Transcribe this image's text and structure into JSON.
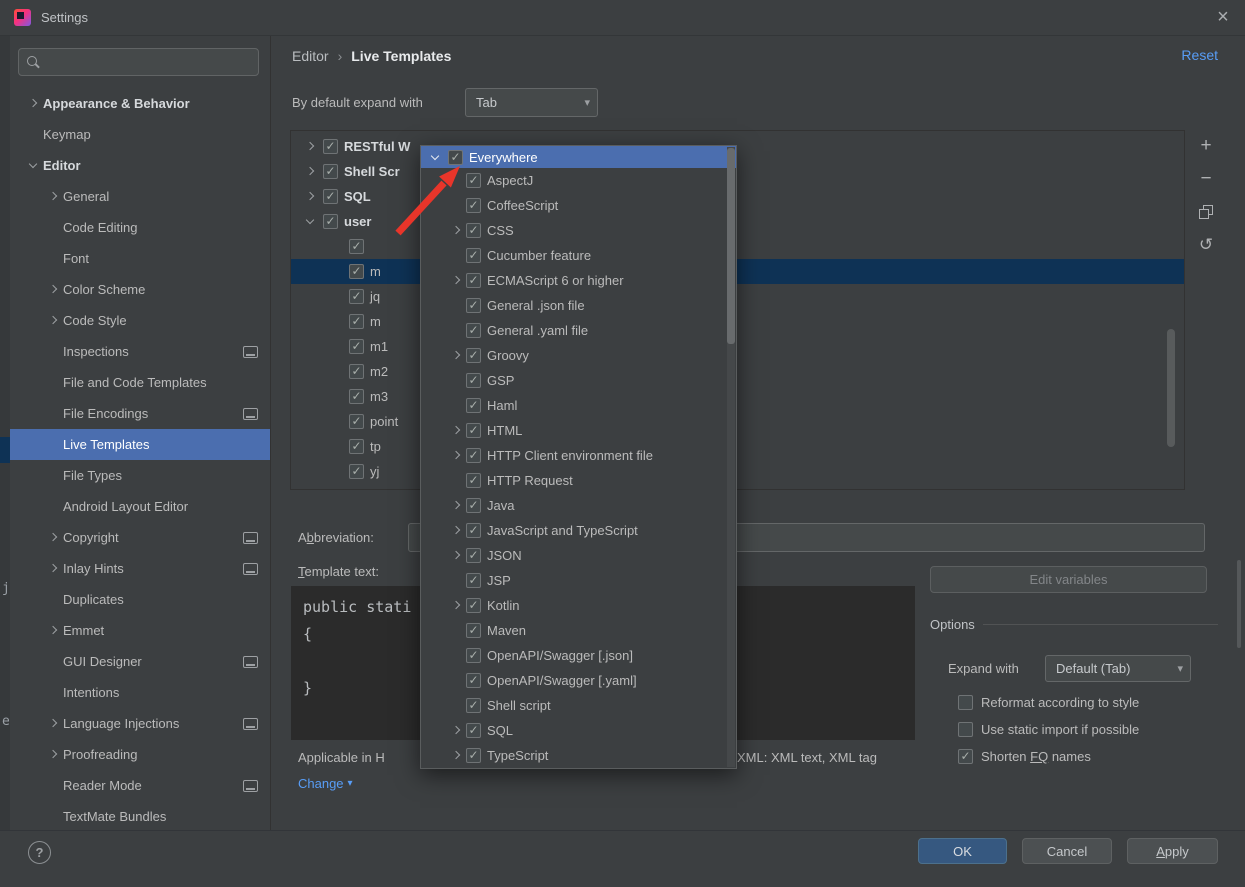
{
  "colors": {
    "background": "#3c3f41",
    "editor_background": "#2b2b2b",
    "selection_blue": "#4b6eaf",
    "inactive_selection": "#0e3255",
    "link_blue": "#589df6",
    "primary_button": "#365880",
    "annotation_red": "#e8352a"
  },
  "icons": {
    "close": "×",
    "add": "+",
    "remove": "−",
    "revert": "↺",
    "dropdown": "▾"
  },
  "title_bar": {
    "title": "Settings"
  },
  "background_strip": {
    "fragments": [
      "j",
      "e"
    ]
  },
  "sidebar": {
    "search": {
      "value": "",
      "placeholder": ""
    },
    "items": [
      {
        "label": "Appearance & Behavior",
        "level": 0,
        "chevron": "collapsed",
        "bold": true
      },
      {
        "label": "Keymap",
        "level": 0
      },
      {
        "label": "Editor",
        "level": 0,
        "chevron": "expanded",
        "bold": true
      },
      {
        "label": "General",
        "level": 1,
        "chevron": "collapsed"
      },
      {
        "label": "Code Editing",
        "level": 1
      },
      {
        "label": "Font",
        "level": 1
      },
      {
        "label": "Color Scheme",
        "level": 1,
        "chevron": "collapsed"
      },
      {
        "label": "Code Style",
        "level": 1,
        "chevron": "collapsed"
      },
      {
        "label": "Inspections",
        "level": 1,
        "monitor": true
      },
      {
        "label": "File and Code Templates",
        "level": 1
      },
      {
        "label": "File Encodings",
        "level": 1,
        "monitor": true
      },
      {
        "label": "Live Templates",
        "level": 1,
        "selected": true
      },
      {
        "label": "File Types",
        "level": 1
      },
      {
        "label": "Android Layout Editor",
        "level": 1
      },
      {
        "label": "Copyright",
        "level": 1,
        "chevron": "collapsed",
        "monitor": true
      },
      {
        "label": "Inlay Hints",
        "level": 1,
        "chevron": "collapsed",
        "monitor": true
      },
      {
        "label": "Duplicates",
        "level": 1
      },
      {
        "label": "Emmet",
        "level": 1,
        "chevron": "collapsed"
      },
      {
        "label": "GUI Designer",
        "level": 1,
        "monitor": true
      },
      {
        "label": "Intentions",
        "level": 1
      },
      {
        "label": "Language Injections",
        "level": 1,
        "chevron": "collapsed",
        "monitor": true
      },
      {
        "label": "Proofreading",
        "level": 1,
        "chevron": "collapsed"
      },
      {
        "label": "Reader Mode",
        "level": 1,
        "monitor": true
      },
      {
        "label": "TextMate Bundles",
        "level": 1
      }
    ]
  },
  "header": {
    "breadcrumb": [
      "Editor",
      "Live Templates"
    ],
    "separator": "›",
    "reset": "Reset"
  },
  "expand_with": {
    "label": "By default expand with",
    "value": "Tab"
  },
  "template_list": {
    "rows": [
      {
        "label": "RESTful W",
        "level": 0,
        "chevron": "collapsed",
        "checked": true,
        "bold": true
      },
      {
        "label": "Shell Scr",
        "level": 0,
        "chevron": "collapsed",
        "checked": true,
        "bold": true
      },
      {
        "label": "SQL",
        "level": 0,
        "chevron": "collapsed",
        "checked": true,
        "bold": true
      },
      {
        "label": "user",
        "level": 0,
        "chevron": "expanded",
        "checked": true,
        "bold": true
      },
      {
        "label": "",
        "level": 1,
        "checked": true
      },
      {
        "label": "m",
        "level": 1,
        "checked": true,
        "selected": true
      },
      {
        "label": "jq",
        "level": 1,
        "checked": true
      },
      {
        "label": "m",
        "level": 1,
        "checked": true
      },
      {
        "label": "m1",
        "level": 1,
        "checked": true
      },
      {
        "label": "m2",
        "level": 1,
        "checked": true
      },
      {
        "label": "m3",
        "level": 1,
        "checked": true
      },
      {
        "label": "point",
        "level": 1,
        "checked": true
      },
      {
        "label": "tp",
        "level": 1,
        "checked": true
      },
      {
        "label": "yj",
        "level": 1,
        "checked": true
      }
    ]
  },
  "abbreviation": {
    "pre": "A",
    "u": "b",
    "post": "breviation:",
    "value": ""
  },
  "template_text": {
    "label_u": "T",
    "label_post": "emplate text:",
    "code_lines": [
      "public stati",
      "{",
      "",
      "}"
    ]
  },
  "edit_variables": "Edit variables",
  "options": {
    "title": "Options",
    "expand_with_label": "Expand with",
    "expand_with_value": "Default (Tab)",
    "checkboxes": [
      {
        "pre": "",
        "u": "",
        "post": "Reformat according to style",
        "checked": false
      },
      {
        "pre": "",
        "u": "",
        "post": "Use static import if possible",
        "checked": false
      },
      {
        "pre": "Shorten ",
        "u": "FQ",
        "post": " names",
        "checked": true
      }
    ]
  },
  "applicable": {
    "left_fragment": "Applicable in H",
    "right_fragment": "XML: XML text, XML tag",
    "change_link": "Change"
  },
  "context_popup": {
    "header": {
      "label": "Everywhere",
      "checked": true
    },
    "items": [
      {
        "label": "AspectJ",
        "checked": true
      },
      {
        "label": "CoffeeScript",
        "checked": true
      },
      {
        "label": "CSS",
        "checked": true,
        "expandable": true
      },
      {
        "label": "Cucumber feature",
        "checked": true
      },
      {
        "label": "ECMAScript 6 or higher",
        "checked": true,
        "expandable": true
      },
      {
        "label": "General .json file",
        "checked": true
      },
      {
        "label": "General .yaml file",
        "checked": true
      },
      {
        "label": "Groovy",
        "checked": true,
        "expandable": true
      },
      {
        "label": "GSP",
        "checked": true
      },
      {
        "label": "Haml",
        "checked": true
      },
      {
        "label": "HTML",
        "checked": true,
        "expandable": true
      },
      {
        "label": "HTTP Client environment file",
        "checked": true,
        "expandable": true
      },
      {
        "label": "HTTP Request",
        "checked": true
      },
      {
        "label": "Java",
        "checked": true,
        "expandable": true
      },
      {
        "label": "JavaScript and TypeScript",
        "checked": true,
        "expandable": true
      },
      {
        "label": "JSON",
        "checked": true,
        "expandable": true
      },
      {
        "label": "JSP",
        "checked": true
      },
      {
        "label": "Kotlin",
        "checked": true,
        "expandable": true
      },
      {
        "label": "Maven",
        "checked": true
      },
      {
        "label": "OpenAPI/Swagger [.json]",
        "checked": true
      },
      {
        "label": "OpenAPI/Swagger [.yaml]",
        "checked": true
      },
      {
        "label": "Shell script",
        "checked": true
      },
      {
        "label": "SQL",
        "checked": true,
        "expandable": true
      },
      {
        "label": "TypeScript",
        "checked": true,
        "expandable": true
      }
    ]
  },
  "footer": {
    "ok": "OK",
    "cancel": "Cancel",
    "apply_u": "A",
    "apply_post": "pply",
    "help": "?"
  }
}
